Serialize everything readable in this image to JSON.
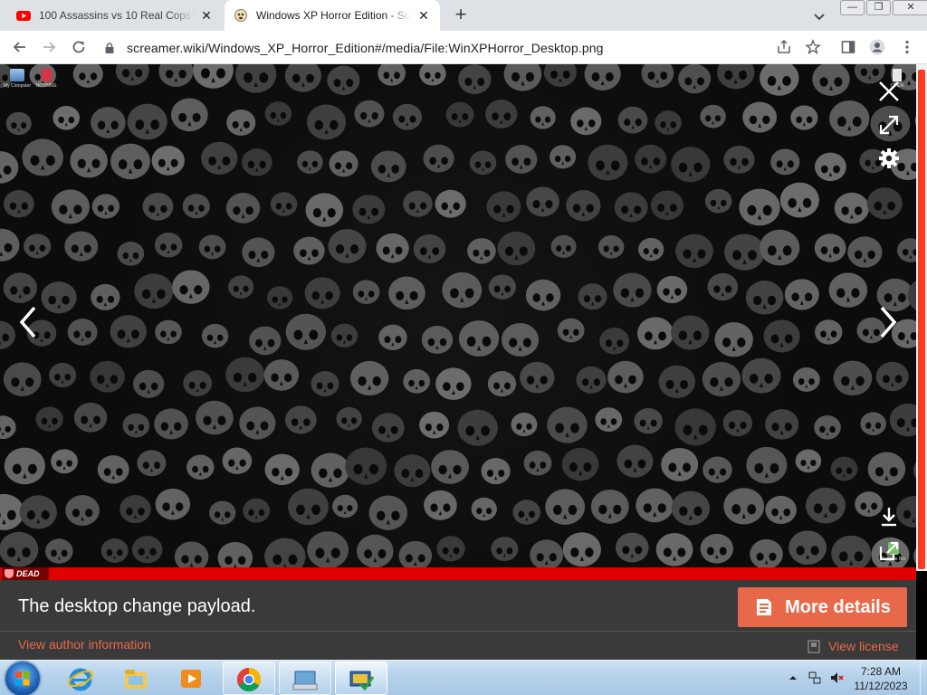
{
  "browser": {
    "tabs": [
      {
        "title": "100 Assassins vs 10 Real Cops! - ",
        "active": false
      },
      {
        "title": "Windows XP Horror Edition - Scr",
        "active": true
      }
    ],
    "url": "screamer.wiki/Windows_XP_Horror_Edition#/media/File:WinXPHorror_Desktop.png"
  },
  "lightbox": {
    "desktop_icons": [
      "My Computer",
      "NOTHING",
      "OPEN",
      "Recycle Bin"
    ],
    "dead_label": "DEAD",
    "caption": "The desktop change payload.",
    "more_details": "More details",
    "author_link": "View author information",
    "license_link": "View license"
  },
  "taskbar": {
    "apps": [
      "internet-explorer",
      "windows-explorer",
      "media-player",
      "chrome",
      "on-screen-keyboard",
      "windows-xp-virtual"
    ],
    "clock_time": "7:28 AM",
    "clock_date": "11/12/2023"
  },
  "colors": {
    "accent": "#e8694a",
    "scroll_thumb": "#ff3b1f",
    "red_bar": "#e00000"
  }
}
